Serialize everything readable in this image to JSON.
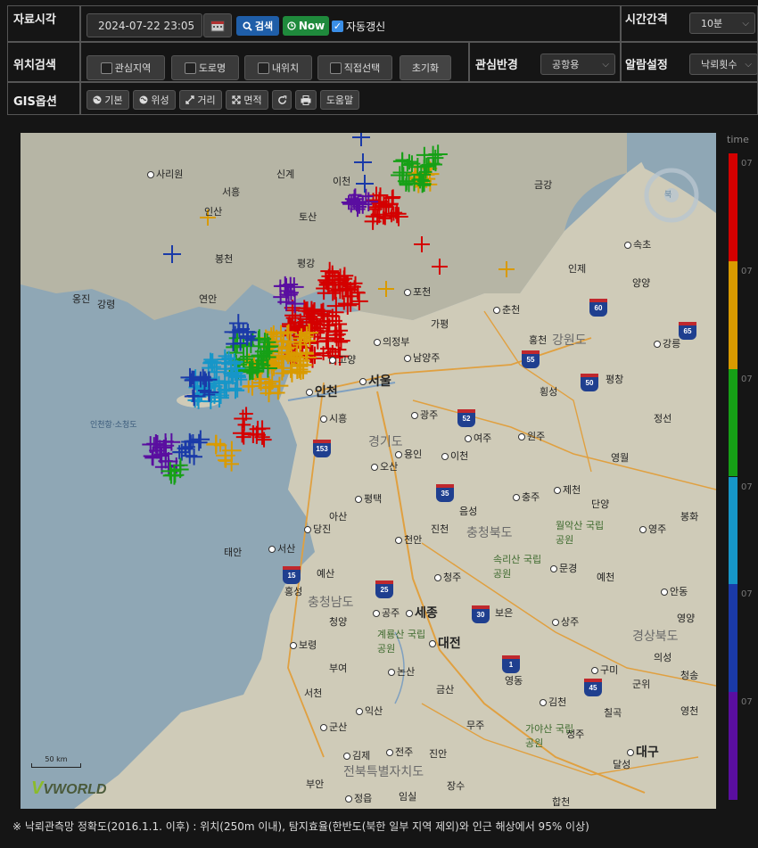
{
  "controls": {
    "row1": {
      "label": "자료시각",
      "datetime_value": "2024-07-22 23:05",
      "calendar_icon": "calendar-icon",
      "search_label": "검색",
      "now_label": "Now",
      "auto_refresh_label": "자동갱신",
      "auto_refresh_checked": true,
      "interval_label": "시간간격",
      "interval_value": "10분"
    },
    "row2": {
      "label": "위치검색",
      "buttons": [
        "관심지역",
        "도로명",
        "내위치",
        "직접선택"
      ],
      "reset_label": "초기화",
      "radius_label": "관심반경",
      "radius_value": "공항용",
      "alarm_label": "알람설정",
      "alarm_value": "낙뢰횟수"
    },
    "row3": {
      "label": "GIS옵션",
      "buttons": [
        "기본",
        "위성",
        "거리",
        "면적"
      ],
      "refresh_icon": "refresh-icon",
      "print_icon": "print-icon",
      "help_label": "도움말"
    }
  },
  "map": {
    "cities": [
      "사리원",
      "서흥",
      "신계",
      "이천",
      "금강",
      "인산",
      "토산",
      "속초",
      "봉천",
      "평강",
      "인제",
      "양양",
      "옹진",
      "강령",
      "연안",
      "포천",
      "춘천",
      "의정부",
      "남양주",
      "가평",
      "홍천",
      "강릉",
      "고양",
      "서울",
      "인천",
      "평창",
      "횡성",
      "정선",
      "시흥",
      "광주",
      "여주",
      "원주",
      "오산",
      "용인",
      "이천",
      "영월",
      "평택",
      "제천",
      "단양",
      "충주",
      "당진",
      "진천",
      "음성",
      "서산",
      "천안",
      "영주",
      "태안",
      "예산",
      "청주",
      "문경",
      "세종",
      "공주",
      "상주",
      "안동",
      "보령",
      "대전",
      "청양",
      "부여",
      "논산",
      "구미",
      "서천",
      "익산",
      "김천",
      "군산",
      "김제",
      "전주",
      "대구",
      "부안",
      "정읍"
    ],
    "provinces": [
      "강원도",
      "경기도",
      "충청북도",
      "충청남도",
      "경상북도",
      "전북특별자치도"
    ],
    "parks": [
      "월악산 국립공원",
      "속리산 국립공원",
      "계룡산 국립공원",
      "가야산 국립공원"
    ],
    "routes": [
      "60",
      "65",
      "55",
      "50",
      "52",
      "153",
      "35",
      "15",
      "25",
      "30",
      "1",
      "45"
    ],
    "other_labels": [
      "인천항·소청도",
      "영동",
      "보은",
      "금산",
      "진안",
      "임실",
      "장수",
      "합천",
      "성주",
      "칠곡",
      "달성",
      "영천",
      "봉화",
      "무주",
      "영양",
      "청송",
      "의성",
      "군위",
      "예천",
      "홍성",
      "아산"
    ],
    "scale_label": "50 km",
    "logo": "VWORLD",
    "compass_label": "북"
  },
  "legend": {
    "title": "time",
    "colors": [
      "#d40000",
      "#d99a00",
      "#16a016",
      "#1696c8",
      "#1a3aa8",
      "#5a0ea0"
    ],
    "labels": [
      "07",
      "07",
      "07",
      "07",
      "07",
      "07"
    ]
  },
  "footer": "※ 낙뢰관측망 정확도(2016.1.1. 이후) : 위치(250m 이내), 탐지효율(한반도(북한 일부 지역 제외)와 인근 해상에서 95% 이상)"
}
